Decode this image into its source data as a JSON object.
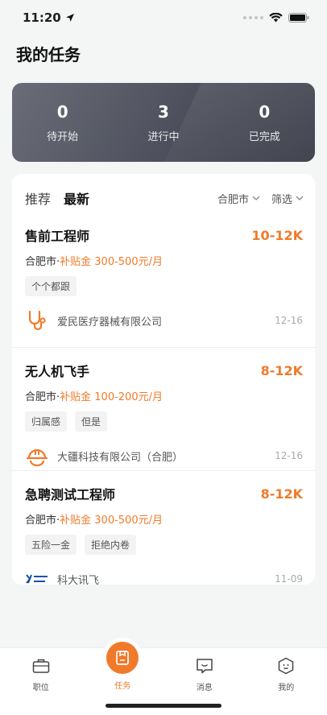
{
  "status": {
    "time": "11:20"
  },
  "page": {
    "title": "我的任务"
  },
  "stats": [
    {
      "value": "0",
      "label": "待开始"
    },
    {
      "value": "3",
      "label": "进行中"
    },
    {
      "value": "0",
      "label": "已完成"
    }
  ],
  "list": {
    "tabs": [
      "推荐",
      "最新"
    ],
    "filter_city": "合肥市",
    "filter_label": "筛选"
  },
  "jobs": [
    {
      "title": "售前工程师",
      "salary": "10-12K",
      "city": "合肥市·",
      "subsidy": "补贴金 300-500元/月",
      "tags": [
        "个个都跟"
      ],
      "company": "爱民医疗器械有限公司",
      "date": "12-16",
      "logo_icon": "stethoscope-icon"
    },
    {
      "title": "无人机飞手",
      "salary": "8-12K",
      "city": "合肥市·",
      "subsidy": "补贴金 100-200元/月",
      "tags": [
        "归属感",
        "但是"
      ],
      "company": "大疆科技有限公司（合肥）",
      "date": "12-16",
      "logo_icon": "hardhat-icon"
    },
    {
      "title": "急聘测试工程师",
      "salary": "8-12K",
      "city": "合肥市·",
      "subsidy": "补贴金 300-500元/月",
      "tags": [
        "五险一金",
        "拒绝内卷"
      ],
      "company": "科大讯飞",
      "date": "11-09",
      "logo_icon": "iflytek-logo"
    }
  ],
  "tabbar": [
    {
      "label": "职位",
      "icon": "briefcase-icon"
    },
    {
      "label": "任务",
      "icon": "task-icon"
    },
    {
      "label": "消息",
      "icon": "message-icon"
    },
    {
      "label": "我的",
      "icon": "profile-icon"
    }
  ],
  "colors": {
    "accent": "#f07a2a",
    "dark_card": "#4d505c"
  }
}
